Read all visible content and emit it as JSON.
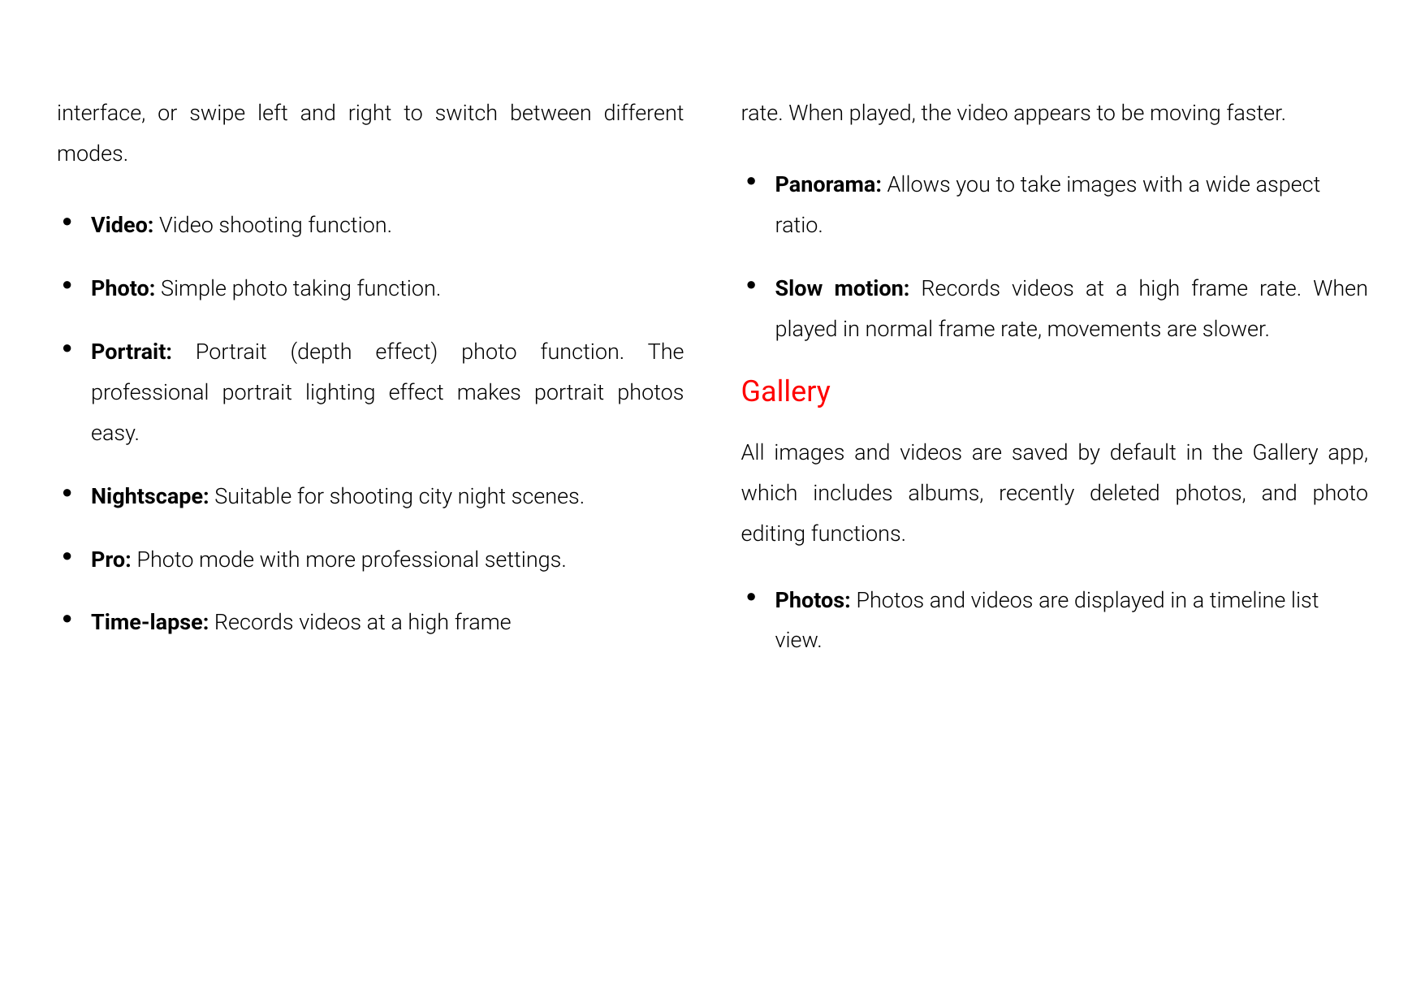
{
  "left": {
    "intro": "interface, or swipe left and right to switch between different modes.",
    "items": [
      {
        "term": "Video:",
        "desc": " Video shooting function."
      },
      {
        "term": "Photo:",
        "desc": " Simple photo taking function."
      },
      {
        "term": "Portrait:",
        "desc": " Portrait (depth effect) photo function. The professional portrait lighting effect makes portrait photos easy."
      },
      {
        "term": "Nightscape:",
        "desc": " Suitable for shooting city night scenes."
      },
      {
        "term": "Pro:",
        "desc": " Photo mode with more professional settings."
      },
      {
        "term": "Time-lapse:",
        "desc": " Records videos at a high frame"
      }
    ]
  },
  "right": {
    "continuation": "rate. When played, the video appears to be moving faster.",
    "items": [
      {
        "term": "Panorama:",
        "desc": " Allows you to take images with a wide aspect ratio."
      },
      {
        "term": "Slow motion:",
        "desc": " Records videos at a high frame rate. When played in normal frame rate, movements are slower."
      }
    ],
    "heading": "Gallery",
    "galleryIntro": "All images and videos are saved by default in the Gallery app, which includes albums, recently deleted photos, and photo editing functions.",
    "galleryItems": [
      {
        "term": "Photos:",
        "desc": " Photos and videos are displayed in a timeline list view."
      }
    ]
  }
}
